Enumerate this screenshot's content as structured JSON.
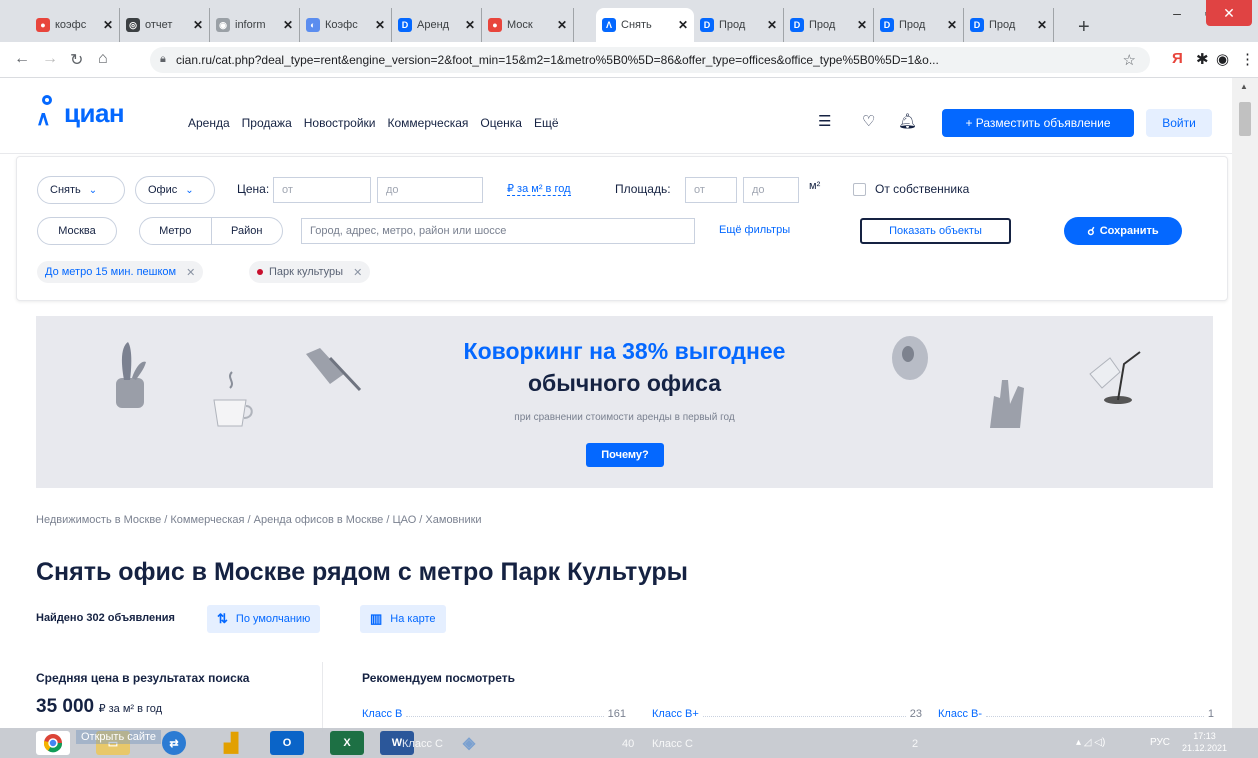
{
  "browser": {
    "tabs": [
      {
        "title": "коэфс",
        "fav_color": "#e8453c",
        "fav_glyph": "●"
      },
      {
        "title": "отчет",
        "fav_color": "#3c4043",
        "fav_glyph": "◎"
      },
      {
        "title": "inform",
        "fav_color": "#9aa0a6",
        "fav_glyph": "◉"
      },
      {
        "title": "Коэфс",
        "fav_color": "#5b8def",
        "fav_glyph": "◐"
      },
      {
        "title": "Аренд",
        "fav_color": "#0468ff",
        "fav_glyph": "D"
      },
      {
        "title": "Моск",
        "fav_color": "#e8453c",
        "fav_glyph": "●"
      },
      {
        "title": "Снять",
        "fav_color": "#0468ff",
        "fav_glyph": "Λ"
      },
      {
        "title": "Прод",
        "fav_color": "#0468ff",
        "fav_glyph": "D"
      },
      {
        "title": "Прод",
        "fav_color": "#0468ff",
        "fav_glyph": "D"
      },
      {
        "title": "Прод",
        "fav_color": "#0468ff",
        "fav_glyph": "D"
      },
      {
        "title": "Прод",
        "fav_color": "#0468ff",
        "fav_glyph": "D"
      }
    ],
    "url": "cian.ru/cat.php?deal_type=rent&engine_version=2&foot_min=15&m2=1&metro%5B0%5D=86&offer_type=offices&office_type%5B0%5D=1&o..."
  },
  "header": {
    "logo": "циан",
    "nav": [
      "Аренда",
      "Продажа",
      "Новостройки",
      "Коммерческая",
      "Оценка",
      "Ещё"
    ],
    "post_label": "+ Разместить объявление",
    "login_label": "Войти"
  },
  "filters": {
    "deal": "Снять",
    "type": "Офис",
    "price_label": "Цена:",
    "price_from": "от",
    "price_to": "до",
    "price_unit": "₽ за м² в год",
    "area_label": "Площадь:",
    "area_from": "от",
    "area_to": "до",
    "area_unit": "м²",
    "owner_label": "От собственника",
    "city": "Москва",
    "metro_label": "Метро",
    "district_label": "Район",
    "search_placeholder": "Город, адрес, метро, район или шоссе",
    "more_filters": "Ещё фильтры",
    "show_label": "Показать объекты",
    "save_label": "Сохранить",
    "tags": [
      {
        "text": "До метро 15 мин. пешком"
      },
      {
        "text": "Парк культуры",
        "dot_color": "#c8102e"
      }
    ]
  },
  "banner": {
    "title_line1": "Коворкинг на 38% выгоднее",
    "title_line2": "обычного офиса",
    "subtitle": "при сравнении стоимости аренды в первый год",
    "button": "Почему?"
  },
  "breadcrumbs": "Недвижимость в Москве / Коммерческая / Аренда офисов в Москве / ЦАО / Хамовники",
  "page_title": "Снять офис в Москве рядом с метро Парк Культуры",
  "results": {
    "found": "Найдено 302 объявления",
    "sort_label": "По умолчанию",
    "map_label": "На карте"
  },
  "avg_price": {
    "heading": "Средняя цена в результатах поиска",
    "value": "35 000",
    "unit": "₽ за м² в год"
  },
  "recommend": {
    "heading": "Рекомендуем посмотреть",
    "items": [
      {
        "name": "Класс B",
        "count": "161"
      },
      {
        "name": "Класс B+",
        "count": "23"
      },
      {
        "name": "Класс B-",
        "count": "1"
      }
    ],
    "ghost_items": [
      {
        "name": "Класс С",
        "count": "40"
      },
      {
        "name": "Класс C",
        "count": "2"
      }
    ]
  },
  "taskbar": {
    "tooltip": "Открыть сайте",
    "lang": "РУС",
    "time": "17:13",
    "date": "21.12.2021"
  },
  "colors": {
    "brand": "#0468ff",
    "text": "#152242",
    "banner_bg": "#e8e9ee"
  }
}
